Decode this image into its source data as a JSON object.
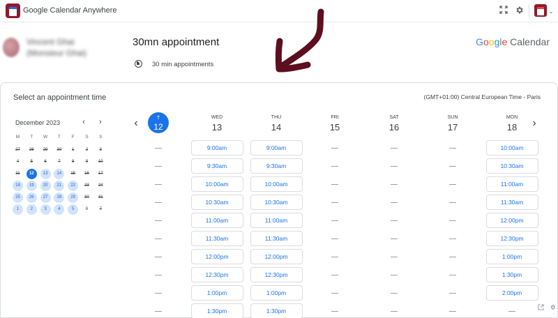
{
  "app": {
    "title": "Google Calendar Anywhere"
  },
  "toolbar_icons": [
    "fullscreen-icon",
    "gear-icon",
    "app-menu-chevron-icon"
  ],
  "host": {
    "name_line1": "Vincent Ghai",
    "name_line2": "(Monsieur Ghai)"
  },
  "appointment": {
    "title": "30mn appointment",
    "duration_label": "30 min appointments"
  },
  "brand": {
    "google": "Google",
    "calendar": "Calendar",
    "colors": {
      "blue": "#4285f4",
      "red": "#ea4335",
      "yellow": "#fbbc05",
      "green": "#34a853"
    }
  },
  "annotation": {
    "arrow_color": "#5c0f1e"
  },
  "panel": {
    "title": "Select an appointment time",
    "timezone": "(GMT+01:00) Central European Time - Paris"
  },
  "mini_calendar": {
    "month_label": "December 2023",
    "prev_icon": "‹",
    "next_icon": "›",
    "dows": [
      "M",
      "T",
      "W",
      "T",
      "F",
      "S",
      "S"
    ],
    "weeks": [
      [
        {
          "d": "27",
          "s": "past"
        },
        {
          "d": "28",
          "s": "past"
        },
        {
          "d": "29",
          "s": "past"
        },
        {
          "d": "30",
          "s": "past"
        },
        {
          "d": "1",
          "s": "past"
        },
        {
          "d": "2",
          "s": "past"
        },
        {
          "d": "3",
          "s": "past"
        }
      ],
      [
        {
          "d": "4",
          "s": "past"
        },
        {
          "d": "5",
          "s": "past"
        },
        {
          "d": "6",
          "s": "past"
        },
        {
          "d": "7",
          "s": "past"
        },
        {
          "d": "8",
          "s": "past"
        },
        {
          "d": "9",
          "s": "past"
        },
        {
          "d": "10",
          "s": "past"
        }
      ],
      [
        {
          "d": "11",
          "s": "past"
        },
        {
          "d": "12",
          "s": "sel"
        },
        {
          "d": "13",
          "s": "avail"
        },
        {
          "d": "14",
          "s": "avail"
        },
        {
          "d": "15",
          "s": "past"
        },
        {
          "d": "16",
          "s": "past"
        },
        {
          "d": "17",
          "s": "past"
        }
      ],
      [
        {
          "d": "18",
          "s": "avail"
        },
        {
          "d": "19",
          "s": "avail"
        },
        {
          "d": "20",
          "s": "avail"
        },
        {
          "d": "21",
          "s": "avail"
        },
        {
          "d": "22",
          "s": "avail"
        },
        {
          "d": "23",
          "s": "past"
        },
        {
          "d": "24",
          "s": "past"
        }
      ],
      [
        {
          "d": "25",
          "s": "avail"
        },
        {
          "d": "26",
          "s": "avail"
        },
        {
          "d": "27",
          "s": "avail"
        },
        {
          "d": "28",
          "s": "avail"
        },
        {
          "d": "29",
          "s": "avail"
        },
        {
          "d": "30",
          "s": "past"
        },
        {
          "d": "31",
          "s": "past"
        }
      ],
      [
        {
          "d": "1",
          "s": "avail"
        },
        {
          "d": "2",
          "s": "avail"
        },
        {
          "d": "3",
          "s": "avail"
        },
        {
          "d": "4",
          "s": "avail"
        },
        {
          "d": "5",
          "s": "avail"
        },
        {
          "d": "6",
          "s": "plain"
        },
        {
          "d": "7",
          "s": "past"
        }
      ]
    ]
  },
  "week": {
    "prev_icon": "‹",
    "next_icon": "›",
    "days": [
      {
        "dow": "T",
        "num": "12",
        "today": true,
        "slots": []
      },
      {
        "dow": "WED",
        "num": "13",
        "slots": [
          "9:00am",
          "9:30am",
          "10:00am",
          "10:30am",
          "11:00am",
          "11:30am",
          "12:00pm",
          "12:30pm",
          "1:00pm",
          "1:30pm"
        ]
      },
      {
        "dow": "THU",
        "num": "14",
        "slots": [
          "9:00am",
          "9:30am",
          "10:00am",
          "10:30am",
          "11:00am",
          "11:30am",
          "12:00pm",
          "12:30pm",
          "1:00pm",
          "1:30pm"
        ]
      },
      {
        "dow": "FRI",
        "num": "15",
        "slots": []
      },
      {
        "dow": "SAT",
        "num": "16",
        "slots": []
      },
      {
        "dow": "SUN",
        "num": "17",
        "slots": []
      },
      {
        "dow": "MON",
        "num": "18",
        "slots": [
          "10:00am",
          "10:30am",
          "11:00am",
          "11:30am",
          "12:00pm",
          "12:30pm",
          "1:00pm",
          "1:30pm",
          "2:00pm"
        ]
      }
    ]
  },
  "footer_icons": [
    "open-external-icon",
    "settings-icon"
  ]
}
